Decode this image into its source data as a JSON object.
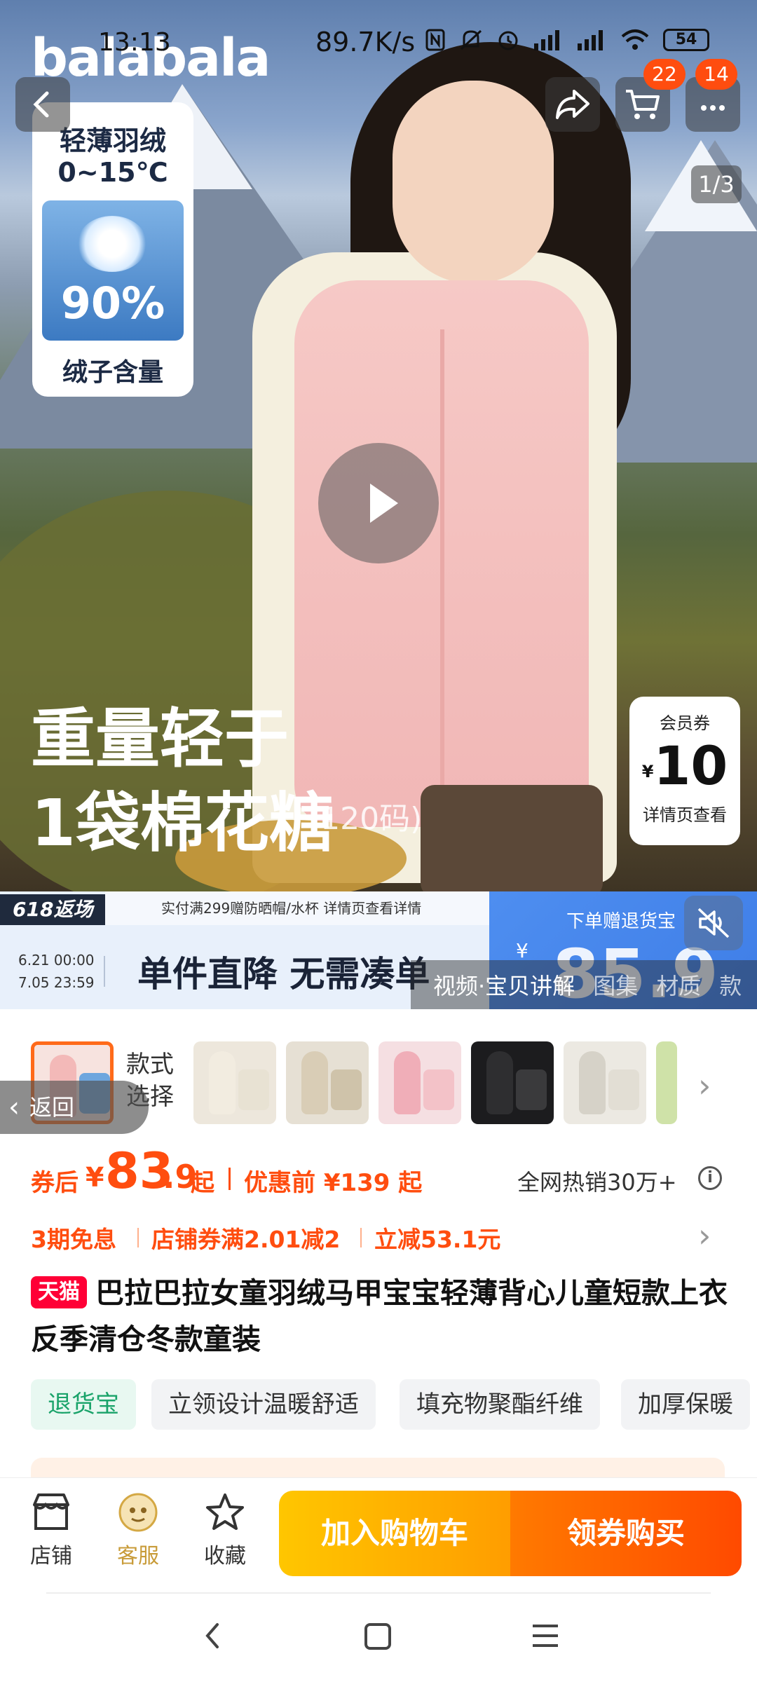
{
  "status_bar": {
    "time": "13:13",
    "net_speed": "89.7K/s",
    "battery": "54"
  },
  "hero": {
    "brand_logo": "balabala",
    "cart_badge": "22",
    "message_badge": "14",
    "image_counter": "1/3",
    "feature_card": {
      "line1": "轻薄羽绒",
      "line2": "0~15℃",
      "percent": "90%",
      "caption": "绒子含量"
    },
    "slogan_line1": "重量轻于",
    "slogan_line2": "1袋棉花糖",
    "slogan_sub": "(120码)",
    "coupon": {
      "title": "会员券",
      "currency": "¥",
      "amount": "10",
      "desc": "详情页查看"
    }
  },
  "promo_banner": {
    "tag": "618返场",
    "top_text": "实付满299赠防晒帽/水杯 详情页查看详情",
    "date_start": "6.21 00:00",
    "date_end": "7.05 23:59",
    "main_text": "单件直降 无需凑单",
    "right_title": "下单赠退货宝",
    "right_currency": "¥",
    "right_price": "85.9"
  },
  "video_tabs": {
    "video": "视频·宝贝讲解",
    "gallery": "图集",
    "material": "材质",
    "more": "款"
  },
  "styles": {
    "label": "款式\n选择",
    "back_label": "返回"
  },
  "price": {
    "after_label": "券后",
    "currency": "¥",
    "integer": "83",
    "decimal": ".9",
    "qi": "起",
    "original_text": "优惠前 ¥139 起",
    "hot_text": "全网热销30万+"
  },
  "promotions": {
    "p1": "3期免息",
    "p2": "店铺券满2.01减2",
    "p3": "立减53.1元"
  },
  "product": {
    "tmall": "天猫",
    "title": "巴拉巴拉女童羽绒马甲宝宝轻薄背心儿童短款上衣反季清仓冬款童装"
  },
  "tags": [
    "退货宝",
    "立领设计温暖舒适",
    "填充物聚酯纤维",
    "加厚保暖"
  ],
  "actions": {
    "store": "店铺",
    "service": "客服",
    "favorite": "收藏",
    "add_cart": "加入购物车",
    "buy": "领券购买"
  },
  "colors": {
    "accent": "#ff4d0f",
    "cart_button": "#ffb300",
    "buy_button": "#ff5a00",
    "tmall": "#ff0036"
  }
}
